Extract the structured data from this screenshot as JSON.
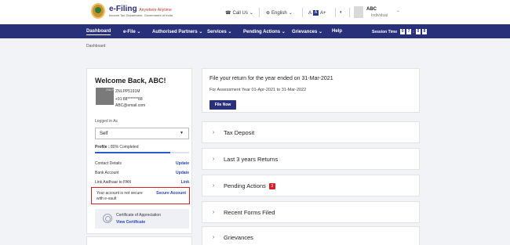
{
  "header": {
    "logo_title": "e-Filing",
    "logo_tagline": "Anywhere Anytime",
    "logo_sub": "Income Tax Department, Government of India",
    "call_us": "Call Us",
    "language": "English",
    "font_smaller": "A",
    "font_normal": "A",
    "font_larger": "A+",
    "user_name": "ABC",
    "user_role": "Individual"
  },
  "nav": {
    "items": [
      {
        "label": "Dashboard"
      },
      {
        "label": "e-File ⌄"
      },
      {
        "label": "Authorised Partners ⌄"
      },
      {
        "label": "Services ⌄"
      },
      {
        "label": "Pending Actions ⌄"
      },
      {
        "label": "Grievances ⌄"
      },
      {
        "label": "Help"
      }
    ],
    "session_label": "Session Time",
    "session_digits": [
      "0",
      "7",
      "0",
      "8"
    ]
  },
  "breadcrumb": "Dashboard",
  "profile_card": {
    "welcome": "Welcome Back, ABC!",
    "photo_label": "ZNLPP",
    "pan": "ZNLPP5191M",
    "phone": "+91 88*******88",
    "email": "ABC@email.com",
    "logged_in_label": "Logged in As",
    "logged_in_value": "Self",
    "profile_label": "Profile : ",
    "profile_value": "80% Completed",
    "profile_progress": 0.8,
    "rows": [
      {
        "label": "Contact Details",
        "action": "Update"
      },
      {
        "label": "Bank Account",
        "action": "Update"
      },
      {
        "label": "Link Aadhaar to PAN",
        "action": "Link"
      }
    ],
    "alert_text": "Your account is not secure with e-vault",
    "alert_action": "Secure Account",
    "cert_title": "Certificate of Appreciation",
    "cert_link": "View Certificate"
  },
  "return_card": {
    "title": "File your return for the year ended on 31-Mar-2021",
    "subtitle": "For Assessment Year 01-Apr-2021 to 31-Mar-2022",
    "button": "File Now"
  },
  "accordions": [
    {
      "label": "Tax Deposit"
    },
    {
      "label": "Last 3 years Returns"
    },
    {
      "label": "Pending Actions",
      "badge": "3"
    },
    {
      "label": "Recent Forms Filed"
    },
    {
      "label": "Grievances"
    }
  ]
}
